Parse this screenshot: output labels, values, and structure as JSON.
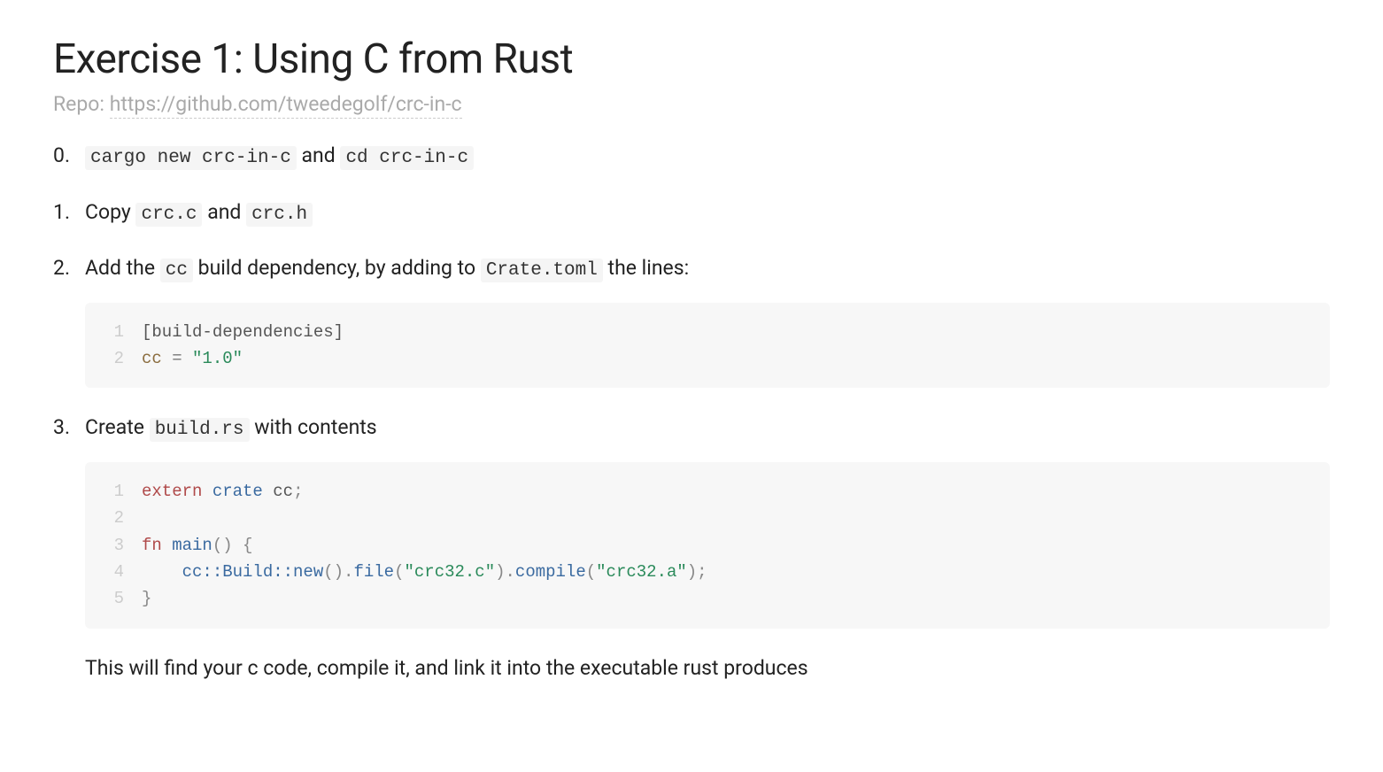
{
  "title": "Exercise 1: Using C from Rust",
  "repo_label": "Repo: ",
  "repo_url_text": "https://github.com/tweedegolf/crc-in-c",
  "steps": {
    "s0": {
      "code1": "cargo new crc-in-c",
      "mid": " and ",
      "code2": "cd crc-in-c"
    },
    "s1": {
      "pre": "Copy ",
      "code1": "crc.c",
      "mid": " and ",
      "code2": "crc.h"
    },
    "s2": {
      "pre": "Add the ",
      "code1": "cc",
      "mid": " build dependency, by adding to ",
      "code2": "Crate.toml",
      "post": " the lines:"
    },
    "s3": {
      "pre": "Create ",
      "code1": "build.rs",
      "post": " with contents"
    }
  },
  "codeblock1": {
    "lines": {
      "n1": "1",
      "n2": "2",
      "l1_section": "[build-dependencies]",
      "l2_key": "cc",
      "l2_eq": " = ",
      "l2_val": "\"1.0\""
    }
  },
  "codeblock2": {
    "lines": {
      "n1": "1",
      "n2": "2",
      "n3": "3",
      "n4": "4",
      "n5": "5",
      "l1_extern": "extern",
      "l1_crate": " crate ",
      "l1_cc": "cc",
      "l1_semi": ";",
      "l3_fn": "fn",
      "l3_main": " main",
      "l3_paren": "()",
      "l3_brace": " {",
      "l4_indent": "    ",
      "l4_path": "cc::Build::new",
      "l4_call1": "().",
      "l4_file": "file",
      "l4_open1": "(",
      "l4_str1": "\"crc32.c\"",
      "l4_close1": ").",
      "l4_compile": "compile",
      "l4_open2": "(",
      "l4_str2": "\"crc32.a\"",
      "l4_close2": ");",
      "l5_brace": "}"
    }
  },
  "followup": "This will find your c code, compile it, and link it into the executable rust produces"
}
